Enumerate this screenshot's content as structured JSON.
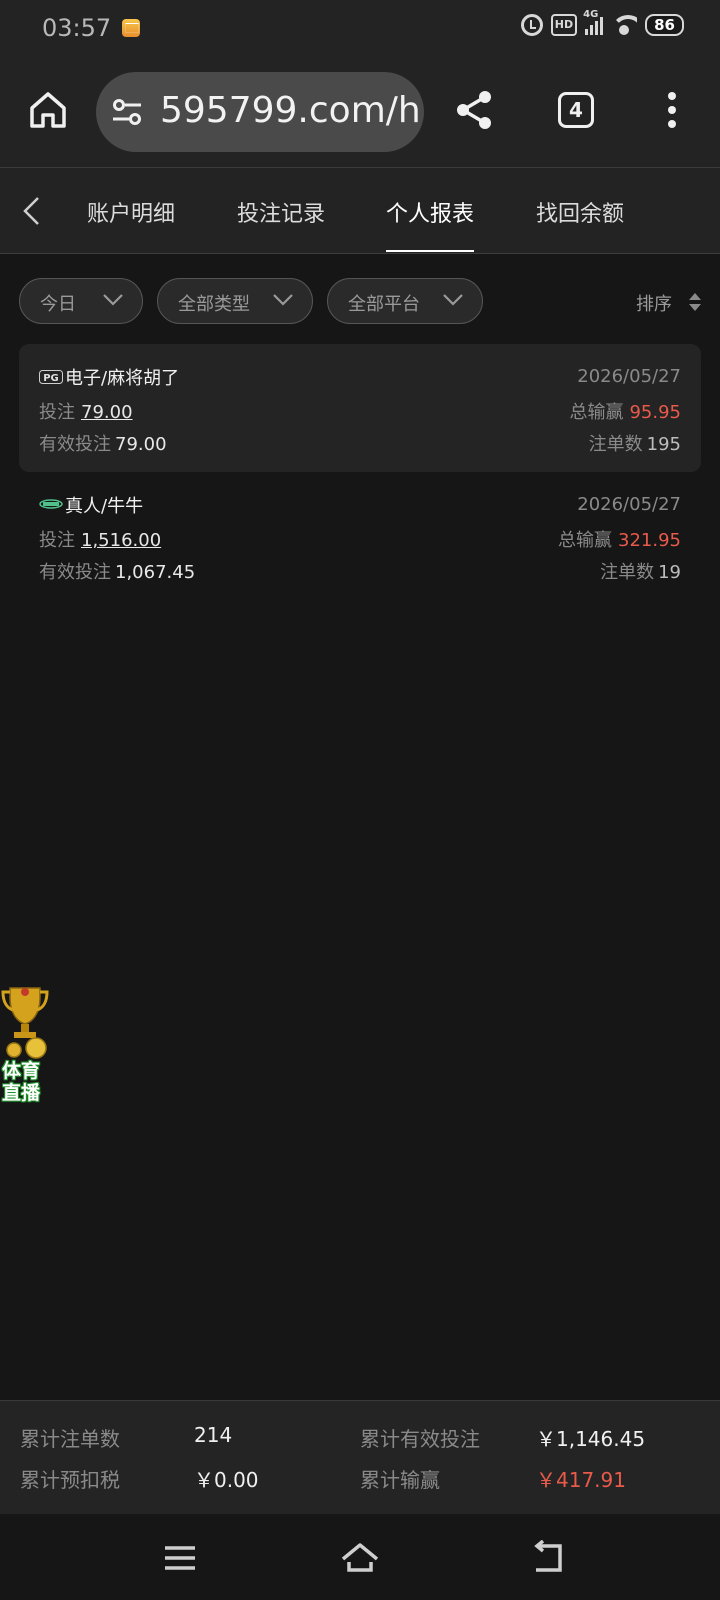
{
  "status_bar": {
    "time": "03:57",
    "hd": "HD",
    "network": "4G",
    "battery": "86"
  },
  "browser": {
    "url": "595799.com/h",
    "tab_count": "4"
  },
  "nav_tabs": [
    {
      "label": "账户明细",
      "active": false
    },
    {
      "label": "投注记录",
      "active": false
    },
    {
      "label": "个人报表",
      "active": true
    },
    {
      "label": "找回余额",
      "active": false
    }
  ],
  "filters": {
    "date": "今日",
    "type": "全部类型",
    "platform": "全部平台",
    "sort": "排序"
  },
  "records": [
    {
      "logo": "PG",
      "title": "电子/麻将胡了",
      "date": "2026/05/27",
      "bet_label": "投注",
      "bet_amount": "79.00",
      "win_label": "总输赢",
      "win_amount": "95.95",
      "valid_label": "有效投注",
      "valid_amount": "79.00",
      "count_label": "注单数",
      "count": "195"
    },
    {
      "logo": "live-dealer-logo",
      "title": "真人/牛牛",
      "date": "2026/05/27",
      "bet_label": "投注",
      "bet_amount": "1,516.00",
      "win_label": "总输赢",
      "win_amount": "321.95",
      "valid_label": "有效投注",
      "valid_amount": "1,067.45",
      "count_label": "注单数",
      "count": "19"
    }
  ],
  "sports_widget": {
    "line1": "体育",
    "line2": "直播"
  },
  "summary": {
    "total_orders_label": "累计注单数",
    "total_orders": "214",
    "total_valid_label": "累计有效投注",
    "total_valid": "￥1,146.45",
    "total_tax_label": "累计预扣税",
    "total_tax": "￥0.00",
    "total_win_label": "累计输赢",
    "total_win": "￥417.91"
  },
  "colors": {
    "background": "#161616",
    "panel": "#242424",
    "accent_red": "#e85a4a"
  }
}
